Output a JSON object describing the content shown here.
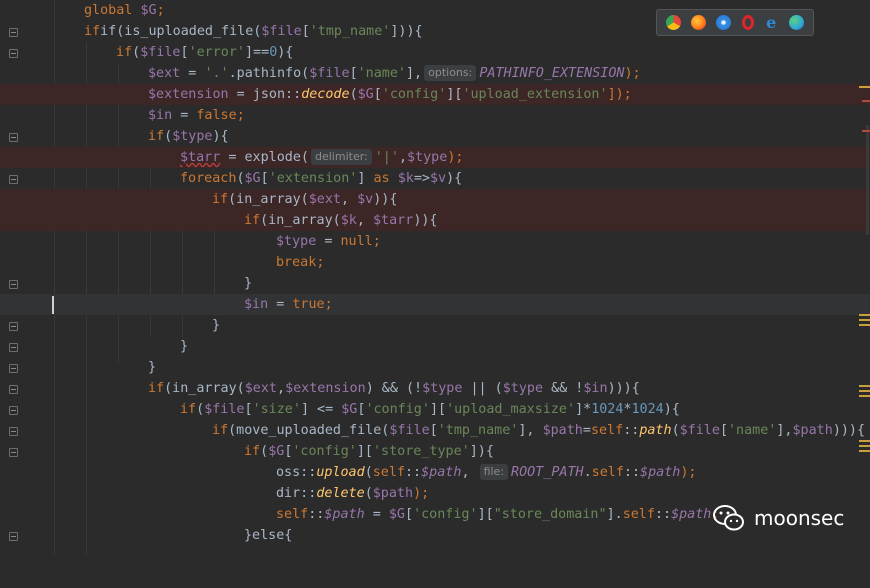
{
  "browsers": [
    {
      "name": "chrome-icon",
      "color": "#e8453c"
    },
    {
      "name": "firefox-icon",
      "color": "#ff7b1c"
    },
    {
      "name": "safari-icon",
      "color": "#3b8fe5"
    },
    {
      "name": "opera-icon",
      "color": "#e0242c"
    },
    {
      "name": "ie-icon",
      "color": "#2b8ad8"
    },
    {
      "name": "edge-icon",
      "color": "#2fa8d8"
    }
  ],
  "watermark": {
    "text": "moonsec"
  },
  "hints": {
    "options": "options:",
    "delimiter": "delimiter:",
    "file": "file:"
  },
  "code": {
    "l0": [
      "global $G;"
    ],
    "l1_a": "if(is_uploaded_file(",
    "l1_b": "$file",
    "l1_c": "[",
    "l1_d": "'tmp_name'",
    "l1_e": "])){",
    "l2_a": "if(",
    "l2_b": "$file",
    "l2_c": "[",
    "l2_d": "'error'",
    "l2_e": "]==",
    "l2_f": "0",
    "l2_g": "){",
    "l3_a": "$ext",
    "l3_b": " = ",
    "l3_c": "'.'",
    "l3_d": ".pathinfo(",
    "l3_e": "$file",
    "l3_f": "[",
    "l3_g": "'name'",
    "l3_h": "],",
    "l3_i": "PATHINFO_EXTENSION",
    "l3_j": ");",
    "l4_a": "$extension",
    "l4_b": " = json::",
    "l4_c": "decode",
    "l4_d": "(",
    "l4_e": "$G",
    "l4_f": "[",
    "l4_g": "'config'",
    "l4_h": "][",
    "l4_i": "'upload_extension'",
    "l4_j": "]);",
    "l5_a": "$in",
    "l5_b": " = ",
    "l5_c": "false",
    "l5_d": ";",
    "l6_a": "if(",
    "l6_b": "$type",
    "l6_c": "){",
    "l7_a": "$tarr",
    "l7_b": " = explode(",
    "l7_c": "'|'",
    "l7_d": ",",
    "l7_e": "$type",
    "l7_f": ");",
    "l8_a": "foreach(",
    "l8_b": "$G",
    "l8_c": "[",
    "l8_d": "'extension'",
    "l8_e": "] ",
    "l8_f": "as",
    "l8_g": " ",
    "l8_h": "$k",
    "l8_i": "=>",
    "l8_j": "$v",
    "l8_k": "){",
    "l9_a": "if(in_array(",
    "l9_b": "$ext",
    "l9_c": ", ",
    "l9_d": "$v",
    "l9_e": ")){",
    "l10_a": "if(in_array(",
    "l10_b": "$k",
    "l10_c": ", ",
    "l10_d": "$tarr",
    "l10_e": ")){",
    "l11_a": "$type",
    "l11_b": " = ",
    "l11_c": "null",
    "l11_d": ";",
    "l12_a": "break",
    "l12_b": ";",
    "l13": "}",
    "l14_a": "$in",
    "l14_b": " = ",
    "l14_c": "true",
    "l14_d": ";",
    "l15": "}",
    "l16": "}",
    "l17": "}",
    "l18_a": "if(in_array(",
    "l18_b": "$ext",
    "l18_c": ",",
    "l18_d": "$extension",
    "l18_e": ") && (!",
    "l18_f": "$type",
    "l18_g": " || (",
    "l18_h": "$type",
    "l18_i": " && !",
    "l18_j": "$in",
    "l18_k": "))){",
    "l19_a": "if(",
    "l19_b": "$file",
    "l19_c": "[",
    "l19_d": "'size'",
    "l19_e": "] <= ",
    "l19_f": "$G",
    "l19_g": "[",
    "l19_h": "'config'",
    "l19_i": "][",
    "l19_j": "'upload_maxsize'",
    "l19_k": "]*",
    "l19_l": "1024",
    "l19_m": "*",
    "l19_n": "1024",
    "l19_o": "){",
    "l20_a": "if(move_uploaded_file(",
    "l20_b": "$file",
    "l20_c": "[",
    "l20_d": "'tmp_name'",
    "l20_e": "], ",
    "l20_f": "$path",
    "l20_g": "=",
    "l20_h": "self",
    "l20_i": "::",
    "l20_j": "path",
    "l20_k": "(",
    "l20_l": "$file",
    "l20_m": "[",
    "l20_n": "'name'",
    "l20_o": "],",
    "l20_p": "$path",
    "l20_q": "))){",
    "l21_a": "if(",
    "l21_b": "$G",
    "l21_c": "[",
    "l21_d": "'config'",
    "l21_e": "][",
    "l21_f": "'store_type'",
    "l21_g": "]){",
    "l22_a": "oss::",
    "l22_b": "upload",
    "l22_c": "(",
    "l22_d": "self",
    "l22_e": "::",
    "l22_f": "$path",
    "l22_g": ", ",
    "l22_h": "ROOT_PATH",
    "l22_i": ".",
    "l22_j": "self",
    "l22_k": "::",
    "l22_l": "$path",
    "l22_m": ");",
    "l23_a": "dir::",
    "l23_b": "delete",
    "l23_c": "(",
    "l23_d": "$path",
    "l23_e": ");",
    "l24_a": "self",
    "l24_b": "::",
    "l24_c": "$path",
    "l24_d": " = ",
    "l24_e": "$G",
    "l24_f": "[",
    "l24_g": "'config'",
    "l24_h": "][",
    "l24_i": "\"store_domain\"",
    "l24_j": "].",
    "l24_k": "self",
    "l24_l": "::",
    "l24_m": "$path",
    "l24_n": ";",
    "l25_a": "}else{"
  }
}
